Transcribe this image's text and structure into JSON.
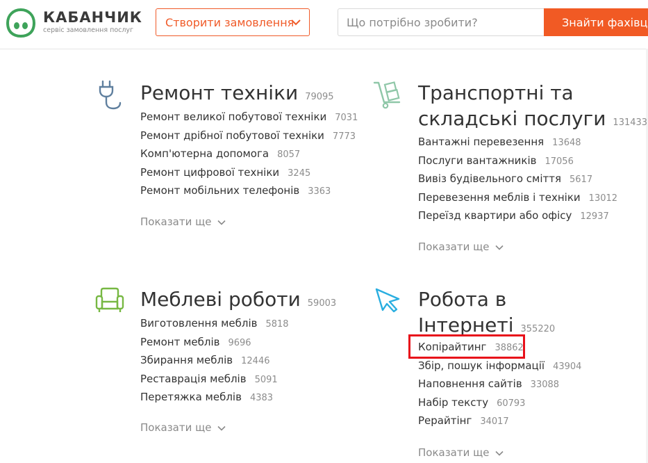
{
  "header": {
    "logo_title": "КАБАНЧИК",
    "logo_subtitle": "сервіс замовлення послуг",
    "create_order_label": "Створити замовлення",
    "search_placeholder": "Що потрібно зробити?",
    "search_button_label": "Знайти фахівця"
  },
  "colors": {
    "accent": "#f15a24",
    "logo_green": "#3ea35a",
    "icon_blue": "#5f7f9e",
    "icon_green": "#77b843",
    "icon_cyan": "#29aee0",
    "highlight_red": "#e8101a"
  },
  "categories": [
    {
      "icon": "plug-icon",
      "title": "Ремонт техніки",
      "count": "79095",
      "links": [
        {
          "label": "Ремонт великої побутової техніки",
          "count": "7031"
        },
        {
          "label": "Ремонт дрібної побутової техніки",
          "count": "7773"
        },
        {
          "label": "Комп'ютерна допомога",
          "count": "8057"
        },
        {
          "label": "Ремонт цифрової техніки",
          "count": "3245"
        },
        {
          "label": "Ремонт мобільних телефонів",
          "count": "3363"
        }
      ],
      "more_label": "Показати ще"
    },
    {
      "icon": "hand-truck-icon",
      "title_line1": "Транспортні та",
      "title_line2": "складські послуги",
      "count": "131433",
      "links": [
        {
          "label": "Вантажні перевезення",
          "count": "13648"
        },
        {
          "label": "Послуги вантажників",
          "count": "17056"
        },
        {
          "label": "Вивіз будівельного сміття",
          "count": "5617"
        },
        {
          "label": "Перевезення меблів і техніки",
          "count": "13012"
        },
        {
          "label": "Переїзд квартири або офісу",
          "count": "12937"
        }
      ],
      "more_label": "Показати ще"
    },
    {
      "icon": "armchair-icon",
      "title": "Меблеві роботи",
      "count": "59003",
      "links": [
        {
          "label": "Виготовлення меблів",
          "count": "5818"
        },
        {
          "label": "Ремонт меблів",
          "count": "9696"
        },
        {
          "label": "Збирання меблів",
          "count": "12446"
        },
        {
          "label": "Реставрація меблів",
          "count": "5091"
        },
        {
          "label": "Перетяжка меблів",
          "count": "4383"
        }
      ],
      "more_label": "Показати ще"
    },
    {
      "icon": "cursor-icon",
      "title_line1": "Робота в",
      "title_line2": "Інтернеті",
      "count": "355220",
      "links": [
        {
          "label": "Копірайтинг",
          "count": "38862"
        },
        {
          "label": "Збір, пошук інформації",
          "count": "43904"
        },
        {
          "label": "Наповнення сайтів",
          "count": "33088"
        },
        {
          "label": "Набір тексту",
          "count": "60793"
        },
        {
          "label": "Рерайтінг",
          "count": "34017"
        }
      ],
      "more_label": "Показати ще"
    }
  ]
}
